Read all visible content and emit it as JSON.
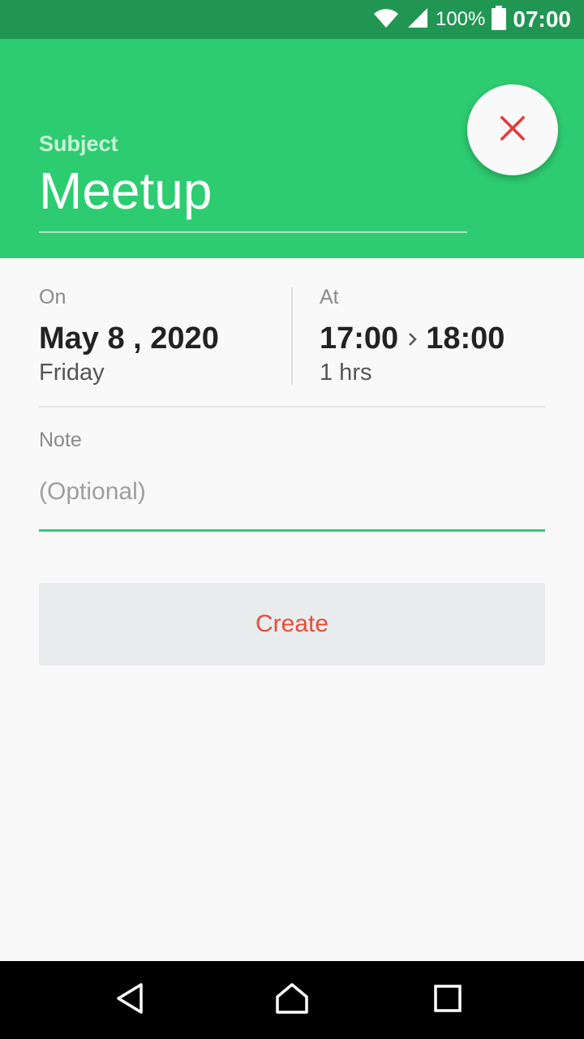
{
  "status_bar": {
    "icons": [
      "wifi-icon",
      "signal-icon",
      "battery-icon"
    ],
    "battery_percent": "100%",
    "time": "07:00"
  },
  "header": {
    "subject_label": "Subject",
    "subject_value": "Meetup",
    "close_icon": "close-icon"
  },
  "date": {
    "label": "On",
    "value": "May 8 , 2020",
    "weekday": "Friday"
  },
  "time": {
    "label": "At",
    "start": "17:00",
    "end": "18:00",
    "duration": "1 hrs"
  },
  "note": {
    "label": "Note",
    "value": "",
    "placeholder": "(Optional)"
  },
  "create_button": {
    "label": "Create"
  },
  "nav_bar": {
    "icons": [
      "back-icon",
      "home-icon",
      "recents-icon"
    ]
  },
  "colors": {
    "accent": "#2ecc71",
    "status_bar": "#219653",
    "close_icon": "#e53935",
    "create_text": "#e74c3c",
    "button_bg": "#e9eced"
  }
}
